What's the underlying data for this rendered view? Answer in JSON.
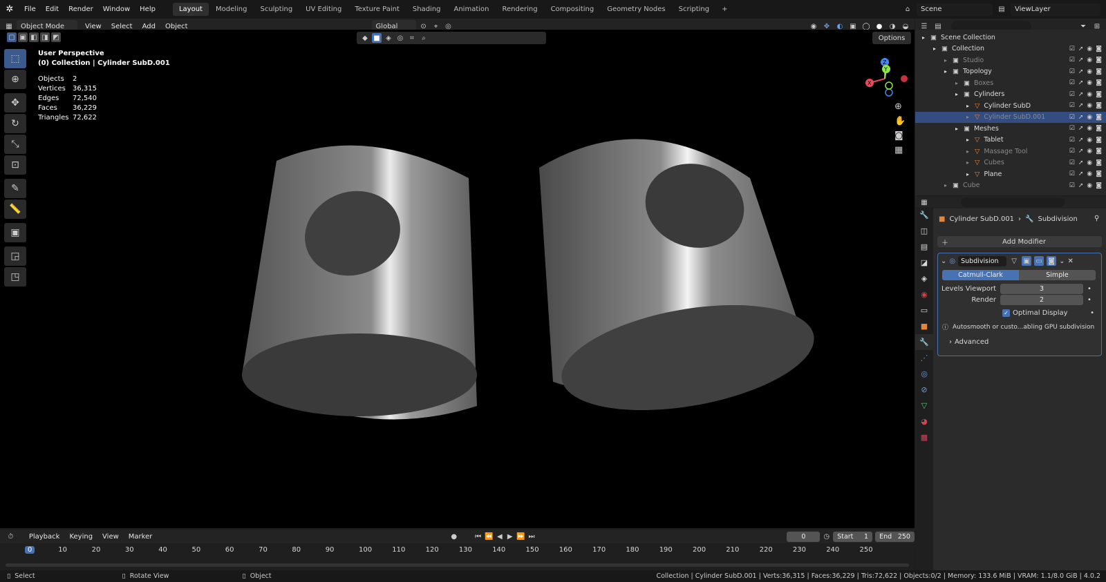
{
  "topbar": {
    "menus": [
      "File",
      "Edit",
      "Render",
      "Window",
      "Help"
    ],
    "workspaces": [
      "Layout",
      "Modeling",
      "Sculpting",
      "UV Editing",
      "Texture Paint",
      "Shading",
      "Animation",
      "Rendering",
      "Compositing",
      "Geometry Nodes",
      "Scripting"
    ],
    "active_workspace": "Layout",
    "add_tab": "+",
    "scene": "Scene",
    "view_layer": "ViewLayer"
  },
  "viewport_header": {
    "mode": "Object Mode",
    "menus": [
      "View",
      "Select",
      "Add",
      "Object"
    ],
    "transform": "Global",
    "options": "Options"
  },
  "viewport": {
    "perspective": "User Perspective",
    "collection": "(0) Collection | Cylinder SubD.001",
    "stats": [
      {
        "label": "Objects",
        "value": "2"
      },
      {
        "label": "Vertices",
        "value": "36,315"
      },
      {
        "label": "Edges",
        "value": "72,540"
      },
      {
        "label": "Faces",
        "value": "36,229"
      },
      {
        "label": "Triangles",
        "value": "72,622"
      }
    ],
    "gizmo": {
      "x": "X",
      "y": "Y",
      "z": "Z"
    }
  },
  "outliner": {
    "rows": [
      {
        "label": "Scene Collection",
        "indent": 0,
        "dim": false,
        "sel": false
      },
      {
        "label": "Collection",
        "indent": 1,
        "dim": false,
        "sel": false
      },
      {
        "label": "Studio",
        "indent": 2,
        "dim": true,
        "sel": false
      },
      {
        "label": "Topology",
        "indent": 2,
        "dim": false,
        "sel": false
      },
      {
        "label": "Boxes",
        "indent": 3,
        "dim": true,
        "sel": false
      },
      {
        "label": "Cylinders",
        "indent": 3,
        "dim": false,
        "sel": false
      },
      {
        "label": "Cylinder SubD",
        "indent": 4,
        "dim": false,
        "sel": false
      },
      {
        "label": "Cylinder SubD.001",
        "indent": 4,
        "dim": true,
        "sel": true
      },
      {
        "label": "Meshes",
        "indent": 3,
        "dim": false,
        "sel": false
      },
      {
        "label": "Tablet",
        "indent": 4,
        "dim": false,
        "sel": false
      },
      {
        "label": "Massage Tool",
        "indent": 4,
        "dim": true,
        "sel": false
      },
      {
        "label": "Cubes",
        "indent": 4,
        "dim": true,
        "sel": false
      },
      {
        "label": "Plane",
        "indent": 4,
        "dim": false,
        "sel": false
      },
      {
        "label": "Cube",
        "indent": 2,
        "dim": true,
        "sel": false
      }
    ]
  },
  "properties": {
    "breadcrumb_object": "Cylinder SubD.001",
    "breadcrumb_modifier": "Subdivision",
    "add_modifier": "Add Modifier",
    "modifier_name": "Subdivision",
    "method_a": "Catmull-Clark",
    "method_b": "Simple",
    "levels_viewport_label": "Levels Viewport",
    "levels_viewport_value": "3",
    "render_label": "Render",
    "render_value": "2",
    "optimal_display": "Optimal Display",
    "info": "Autosmooth or custo...abling GPU subdivision",
    "advanced": "Advanced"
  },
  "timeline": {
    "menus": [
      "Playback",
      "Keying",
      "View",
      "Marker"
    ],
    "current_frame": "0",
    "start_label": "Start",
    "start": "1",
    "end_label": "End",
    "end": "250",
    "ticks": [
      "0",
      "10",
      "20",
      "30",
      "40",
      "50",
      "60",
      "70",
      "80",
      "90",
      "100",
      "110",
      "120",
      "130",
      "140",
      "150",
      "160",
      "170",
      "180",
      "190",
      "200",
      "210",
      "220",
      "230",
      "240",
      "250"
    ]
  },
  "statusbar": {
    "select": "Select",
    "rotate": "Rotate View",
    "object": "Object",
    "info": "Collection | Cylinder SubD.001 | Verts:36,315 | Faces:36,229 | Tris:72,622 | Objects:0/2 | Memory: 133.6 MiB | VRAM: 1.1/8.0 GiB | 4.0.2"
  },
  "colors": {
    "accent": "#4772b3",
    "selection": "#334d80",
    "orange": "#e3883a"
  }
}
